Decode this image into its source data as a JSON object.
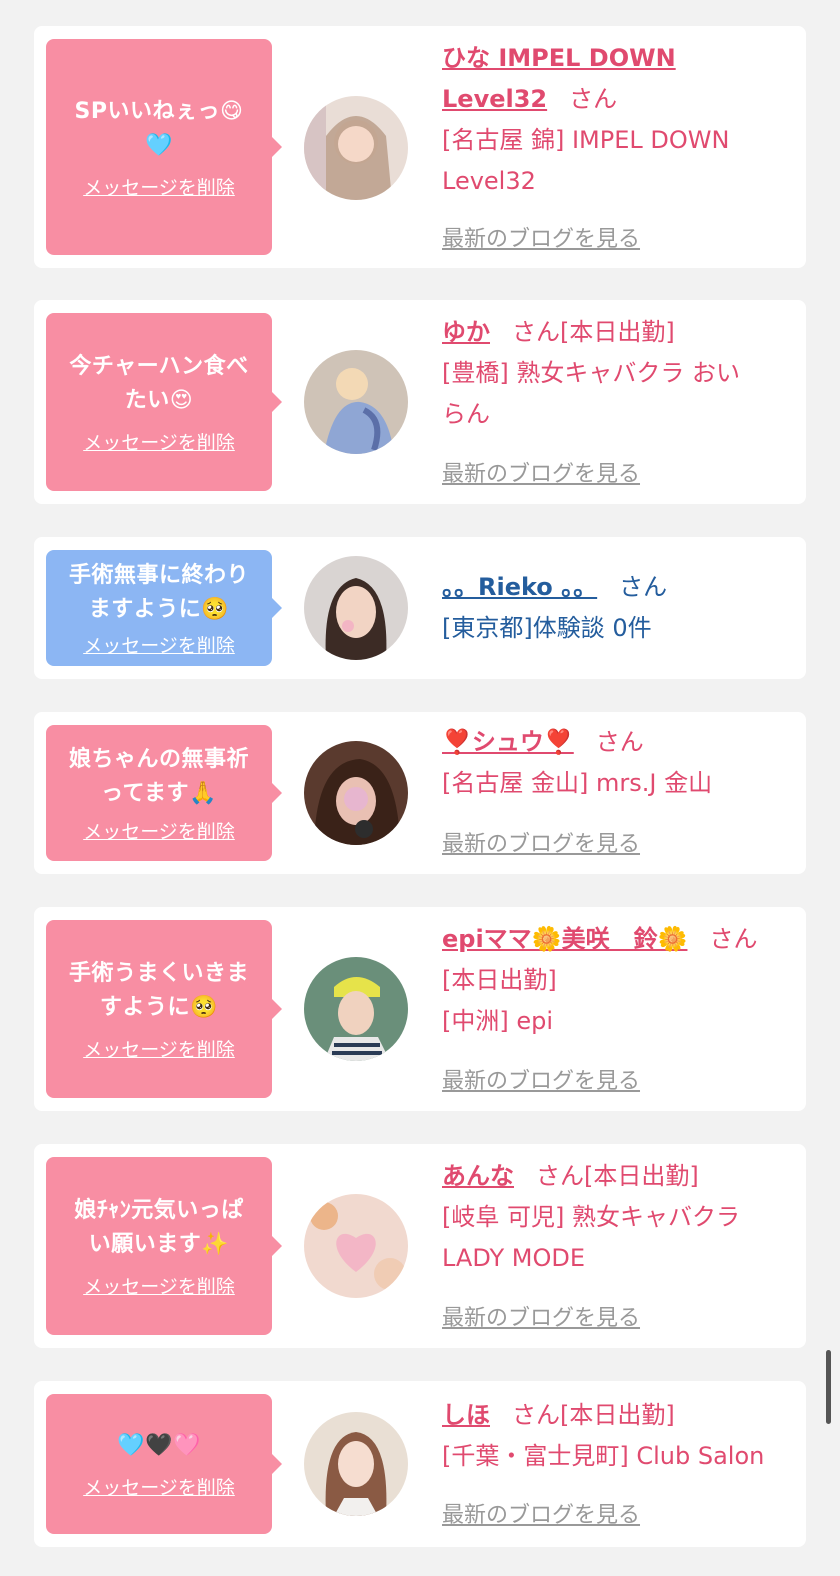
{
  "colors": {
    "page_bg": "#f2f2f2",
    "bubble_pink": "#f88ea3",
    "bubble_blue": "#8cb6f3",
    "name_pink": "#e04a6f",
    "name_blue": "#245d9d",
    "link_gray": "#999999"
  },
  "delete_label": "メッセージを削除",
  "blog_label": "最新のブログを見る",
  "san": "さん",
  "items": [
    {
      "message_lines": [
        "SPいいねぇっ😋",
        "🩵"
      ],
      "bubble_color": "pink",
      "avatar": "avatar-photo-1",
      "name_lines": [
        "ひな IMPEL DOWN",
        "Level32"
      ],
      "status": "",
      "shop_lines": [
        "[名古屋 錦] IMPEL DOWN",
        "Level32"
      ],
      "has_blog": true
    },
    {
      "message_lines": [
        "今チャーハン食べ",
        "たい😍"
      ],
      "bubble_color": "pink",
      "avatar": "avatar-photo-2",
      "name_lines": [
        "ゆか"
      ],
      "status": "[本日出勤]",
      "shop_lines": [
        "[豊橋] 熟女キャバクラ おい",
        "らん"
      ],
      "has_blog": true
    },
    {
      "message_lines": [
        "手術無事に終わり",
        "ますように🥺"
      ],
      "bubble_color": "blue",
      "avatar": "avatar-photo-3",
      "name_lines": [
        "。。Rieko 。。"
      ],
      "status": "",
      "shop_lines": [
        "[東京都]体験談 0件"
      ],
      "has_blog": false
    },
    {
      "message_lines": [
        "娘ちゃんの無事祈",
        "ってます🙏"
      ],
      "bubble_color": "pink",
      "avatar": "avatar-photo-4",
      "name_lines": [
        "❣️シュウ❣️"
      ],
      "status": "",
      "shop_lines": [
        "[名古屋 金山] mrs.J 金山"
      ],
      "has_blog": true
    },
    {
      "message_lines": [
        "手術うまくいきま",
        "すように🥺"
      ],
      "bubble_color": "pink",
      "avatar": "avatar-photo-5",
      "name_lines": [
        "epiママ🌼美咲　鈴🌼"
      ],
      "status": "",
      "shop_lines": [
        "[本日出勤]",
        "[中洲] epi"
      ],
      "has_blog": true
    },
    {
      "message_lines": [
        "娘ﾁｬﾝ元気いっぱ",
        "い願います✨"
      ],
      "bubble_color": "pink",
      "avatar": "avatar-photo-6",
      "name_lines": [
        "あんな"
      ],
      "status": "[本日出勤]",
      "shop_lines": [
        "[岐阜 可児] 熟女キャバクラ",
        "LADY MODE"
      ],
      "has_blog": true
    },
    {
      "message_lines": [
        "🩵🖤🩷"
      ],
      "bubble_color": "pink",
      "avatar": "avatar-photo-7",
      "name_lines": [
        "しほ"
      ],
      "status": "[本日出勤]",
      "shop_lines": [
        "[千葉・富士見町] Club Salon"
      ],
      "has_blog": true
    }
  ]
}
